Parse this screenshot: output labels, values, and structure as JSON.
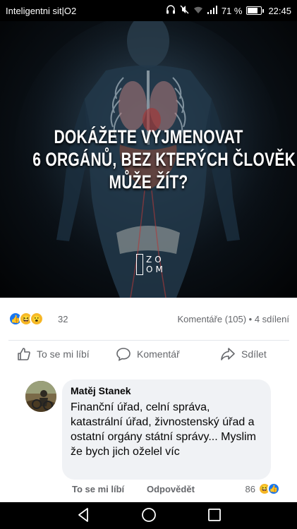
{
  "status_bar": {
    "carrier": "Inteligentni sit|O2",
    "battery": "71 %",
    "time": "22:45",
    "icons": [
      "headphones-icon",
      "mute-icon",
      "wifi-icon",
      "signal-icon",
      "battery-icon"
    ]
  },
  "post_image": {
    "title_lines": [
      "DOKÁŽETE VYJMENOVAT",
      "6 ORGÁNŮ, BEZ KTERÝCH ČLOVĚK",
      "MŮŽE ŽÍT?"
    ],
    "logo_text": "ZOOM"
  },
  "reactions": {
    "count": "32",
    "types": [
      "like",
      "haha",
      "wow"
    ]
  },
  "stats": {
    "comments": "Komentáře (105)",
    "separator": " • ",
    "shares": "4 sdílení"
  },
  "actions": {
    "like": "To se mi líbí",
    "comment": "Komentář",
    "share": "Sdílet"
  },
  "comment": {
    "author": "Matěj Stanek",
    "text": "Finanční úřad, celní správa, katastrální úřad, živnostenský úřad a ostatní orgány státní správy... Myslim že bych jich oželel víc",
    "like_label": "To se mi líbí",
    "reply_label": "Odpovědět",
    "reaction_count": "86"
  },
  "colors": {
    "facebook_blue": "#1877f2",
    "haha_yellow": "#f7b928",
    "secondary_text": "#65676b",
    "bubble_bg": "#f0f2f5"
  }
}
